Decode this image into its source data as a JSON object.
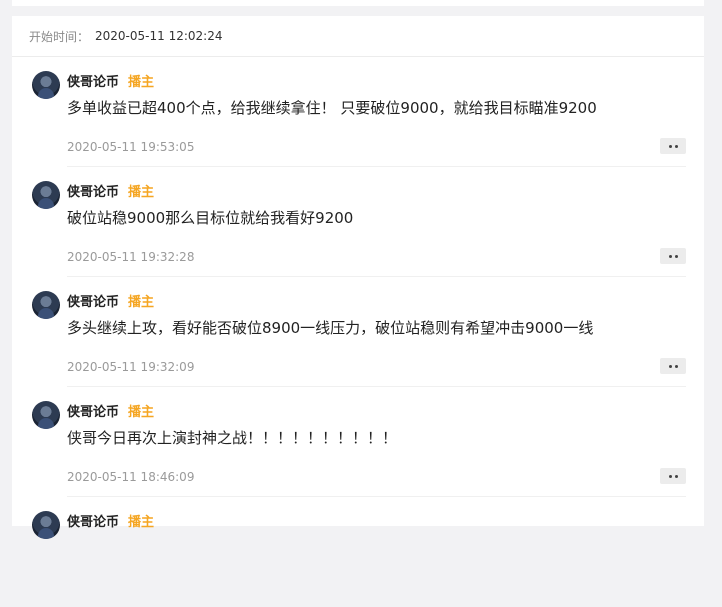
{
  "header": {
    "start_label": "开始时间：",
    "start_time": "2020-05-11 12:02:24"
  },
  "posts": [
    {
      "author": "侠哥论币",
      "badge": "播主",
      "content": "多单收益已超400个点，给我继续拿住！ 只要破位9000，就给我目标瞄准9200",
      "time": "2020-05-11 19:53:05"
    },
    {
      "author": "侠哥论币",
      "badge": "播主",
      "content": "破位站稳9000那么目标位就给我看好9200",
      "time": "2020-05-11 19:32:28"
    },
    {
      "author": "侠哥论币",
      "badge": "播主",
      "content": "多头继续上攻，看好能否破位8900一线压力，破位站稳则有希望冲击9000一线",
      "time": "2020-05-11 19:32:09"
    },
    {
      "author": "侠哥论币",
      "badge": "播主",
      "content": "侠哥今日再次上演封神之战！！！！！！！！！！",
      "time": "2020-05-11 18:46:09"
    },
    {
      "author": "侠哥论币",
      "badge": "播主",
      "content": "",
      "time": ""
    }
  ]
}
